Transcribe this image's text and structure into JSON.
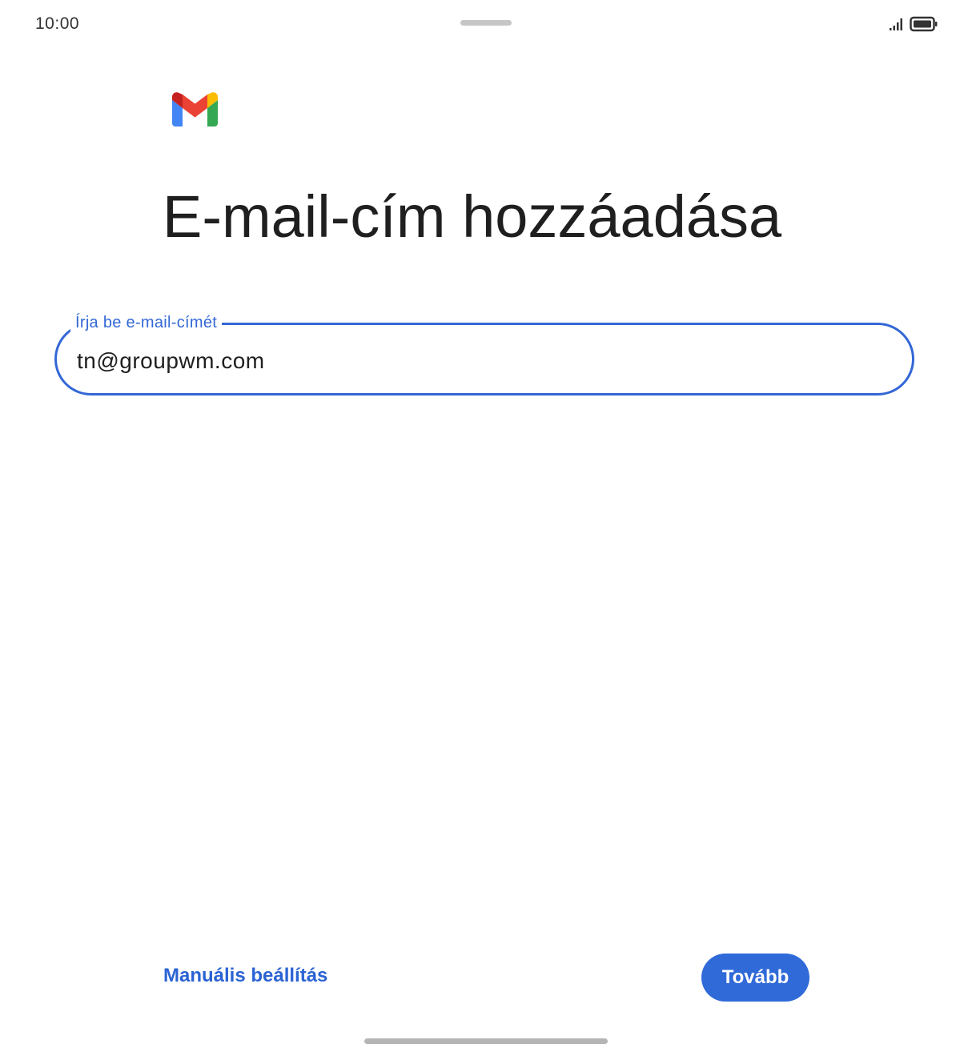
{
  "status_bar": {
    "time": "10:00",
    "icons": [
      "signal-icon",
      "battery-icon"
    ]
  },
  "logo": {
    "name": "gmail-logo",
    "colors": {
      "blue": "#4285F4",
      "red": "#EA4335",
      "yellow": "#FBBC04",
      "green": "#34A853",
      "dark_red": "#C5221F"
    }
  },
  "page": {
    "title": "E-mail-cím hozzáadása"
  },
  "email_field": {
    "label": "Írja be e-mail-címét",
    "value": "tn@groupwm.com"
  },
  "actions": {
    "manual_setup_label": "Manuális beállítás",
    "next_label": "Tovább"
  },
  "colors": {
    "accent": "#3367d6",
    "button": "#2f6ad8"
  }
}
